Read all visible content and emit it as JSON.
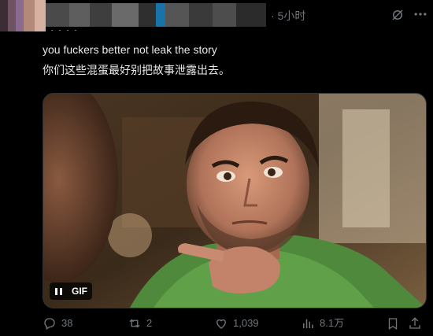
{
  "post": {
    "time": "· 5小时",
    "handle_fragment": "· · · · ·",
    "text_en": "you fuckers better not leak the story",
    "text_zh": "你们这些混蛋最好别把故事泄露出去。",
    "media": {
      "badge": "GIF"
    },
    "actions": {
      "replies": "38",
      "reposts": "2",
      "likes": "1,039",
      "views": "8.1万"
    }
  },
  "icons": {
    "grok": "grok-icon",
    "more": "more-icon",
    "reply": "reply-icon",
    "repost": "repost-icon",
    "like": "heart-icon",
    "views": "views-chart-icon",
    "bookmark": "bookmark-icon",
    "share": "share-icon"
  },
  "colors": {
    "background": "#000000",
    "text": "#e7e9ea",
    "muted": "#71767b"
  }
}
